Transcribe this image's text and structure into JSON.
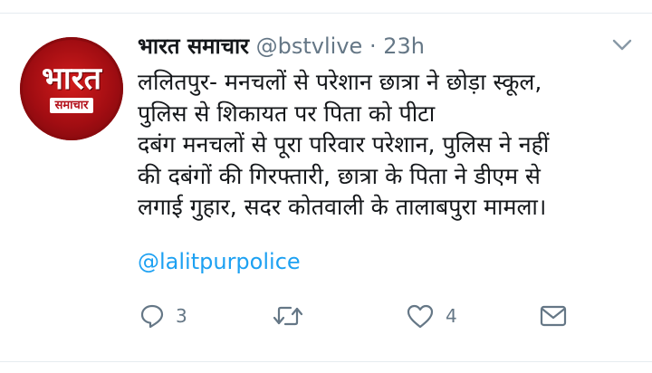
{
  "tweet": {
    "author": {
      "display_name": "भारत समाचार",
      "handle": "@bstvlive",
      "separator": "·",
      "time": "23h",
      "avatar": {
        "logo_word": "भारत",
        "logo_sub": "समाचार",
        "colors": {
          "background": "#c1121a",
          "text": "#ffffff"
        }
      }
    },
    "text_lines": [
      "ललितपुर- मनचलों से परेशान छात्रा ने छोड़ा स्कूल,",
      "पुलिस से शिकायत पर पिता को पीटा",
      "दबंग मनचलों से पूरा परिवार परेशान, पुलिस ने नहीं",
      "की दबंगों की गिरफ्तारी, छात्रा के पिता ने डीएम से",
      "लगाई गुहार, सदर कोतवाली के तालाबपुरा मामला।"
    ],
    "mention": "@lalitpurpolice",
    "actions": {
      "reply": {
        "icon": "reply-icon",
        "count": "3"
      },
      "retweet": {
        "icon": "retweet-icon",
        "count": ""
      },
      "like": {
        "icon": "heart-icon",
        "count": "4"
      },
      "message": {
        "icon": "envelope-icon"
      }
    },
    "menu_icon": "chevron-down-icon"
  },
  "colors": {
    "text": "#14171a",
    "meta": "#657786",
    "link": "#1da1f2",
    "divider": "#e6ecf0"
  }
}
